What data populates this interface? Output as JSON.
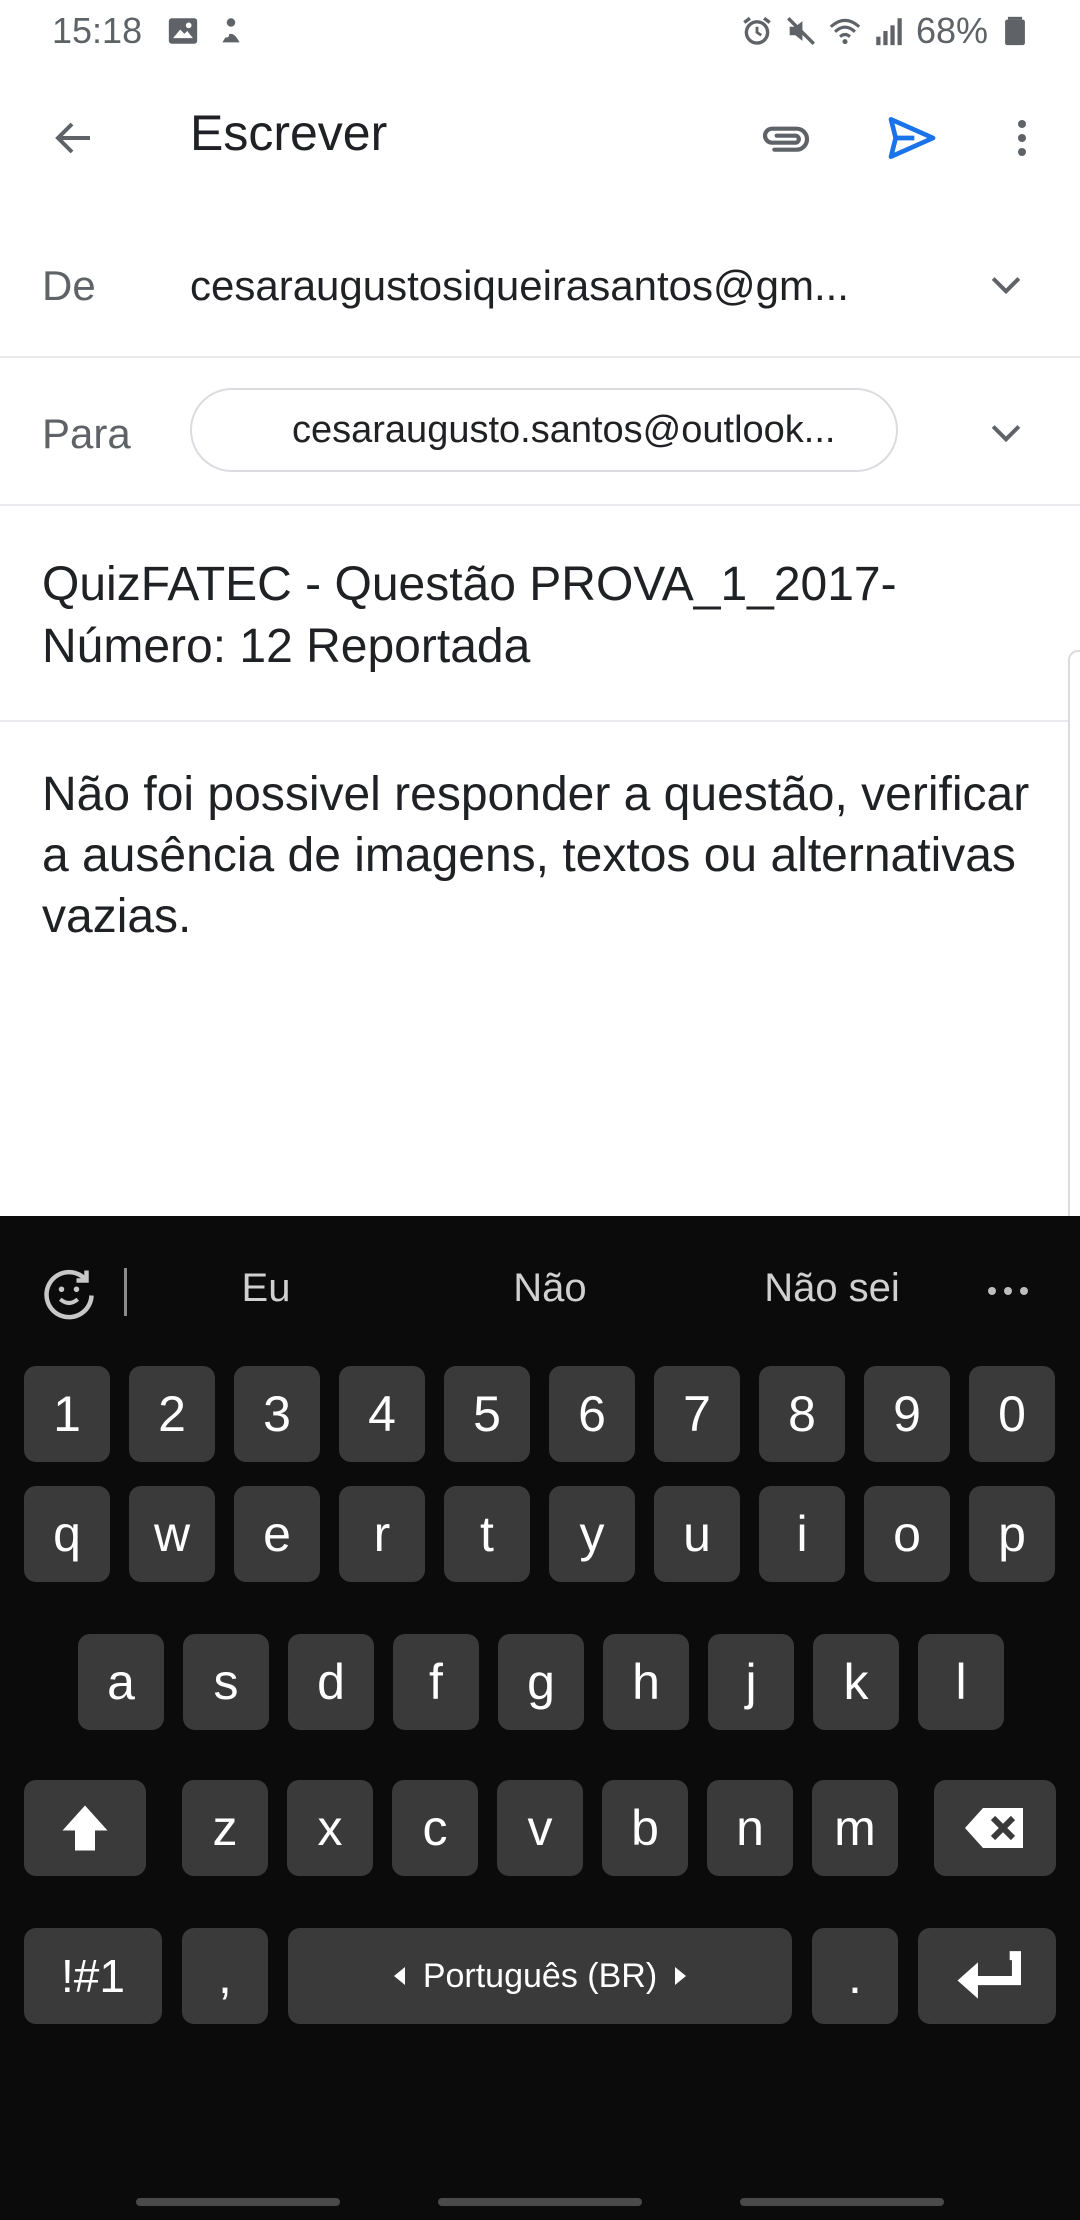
{
  "status_bar": {
    "time": "15:18",
    "battery": "68%",
    "icons_left": [
      "image-icon",
      "notification-icon"
    ],
    "icons_right": [
      "alarm-icon",
      "mute-icon",
      "wifi-icon",
      "signal-icon",
      "battery-icon"
    ]
  },
  "app_bar": {
    "title": "Escrever",
    "accent_color": "#1a73e8"
  },
  "compose": {
    "from_label": "De",
    "from_value": "cesaraugustosiqueirasantos@gm...",
    "to_label": "Para",
    "to_value": "cesaraugusto.santos@outlook...",
    "subject": "QuizFATEC - Questão PROVA_1_2017-Número: 12 Reportada",
    "body": "Não foi possivel responder a questão, verificar a ausência de imagens, textos ou alternativas vazias."
  },
  "keyboard": {
    "suggestions": [
      "Eu",
      "Não",
      "Não sei"
    ],
    "number_row": [
      "1",
      "2",
      "3",
      "4",
      "5",
      "6",
      "7",
      "8",
      "9",
      "0"
    ],
    "row1": [
      "q",
      "w",
      "e",
      "r",
      "t",
      "y",
      "u",
      "i",
      "o",
      "p"
    ],
    "row2": [
      "a",
      "s",
      "d",
      "f",
      "g",
      "h",
      "j",
      "k",
      "l"
    ],
    "row3": [
      "z",
      "x",
      "c",
      "v",
      "b",
      "n",
      "m"
    ],
    "symbols_label": "!#1",
    "comma_label": ",",
    "space_label": "Português (BR)",
    "period_label": "."
  }
}
